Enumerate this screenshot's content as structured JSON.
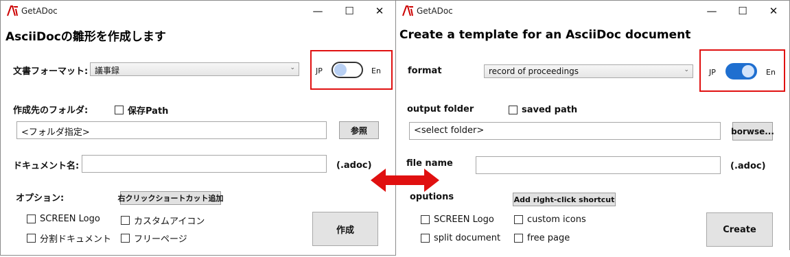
{
  "colors": {
    "highlight_frame": "#e01010",
    "toggle_on": "#1f6fd0",
    "arrow": "#e01010"
  },
  "jp_window": {
    "title": "GetADoc",
    "window_controls": {
      "minimize": "—",
      "maximize": "☐",
      "close": "✕"
    },
    "heading": "AsciiDocの雛形を作成します",
    "format_label": "文書フォーマット:",
    "format_value": "議事録",
    "language_toggle": {
      "left": "JP",
      "right": "En",
      "state": "JP"
    },
    "folder_label": "作成先のフォルダ:",
    "save_path_label": "保存Path",
    "folder_placeholder": "<フォルダ指定>",
    "browse_label": "参照",
    "doc_name_label": "ドキュメント名:",
    "extension": "(.adoc)",
    "options_label": "オプション:",
    "shortcut_button": "右クリックショートカット追加",
    "options": [
      "SCREEN Logo",
      "カスタムアイコン",
      "分割ドキュメント",
      "フリーページ"
    ],
    "create_button": "作成"
  },
  "en_window": {
    "title": "GetADoc",
    "window_controls": {
      "minimize": "—",
      "maximize": "☐",
      "close": "✕"
    },
    "heading": "Create a template for an AsciiDoc document",
    "format_label": "format",
    "format_value": "record of proceedings",
    "language_toggle": {
      "left": "JP",
      "right": "En",
      "state": "En"
    },
    "folder_label": "output folder",
    "save_path_label": "saved path",
    "folder_placeholder": "<select folder>",
    "browse_label": "borwse...",
    "doc_name_label": "file name",
    "extension": "(.adoc)",
    "options_label": "oputions",
    "shortcut_button": "Add right-click shortcut",
    "options": [
      "SCREEN Logo",
      "custom icons",
      "split document",
      "free page"
    ],
    "create_button": "Create"
  },
  "icons": {
    "app": "app-logo-icon",
    "arrow": "double-headed-arrow-icon"
  }
}
